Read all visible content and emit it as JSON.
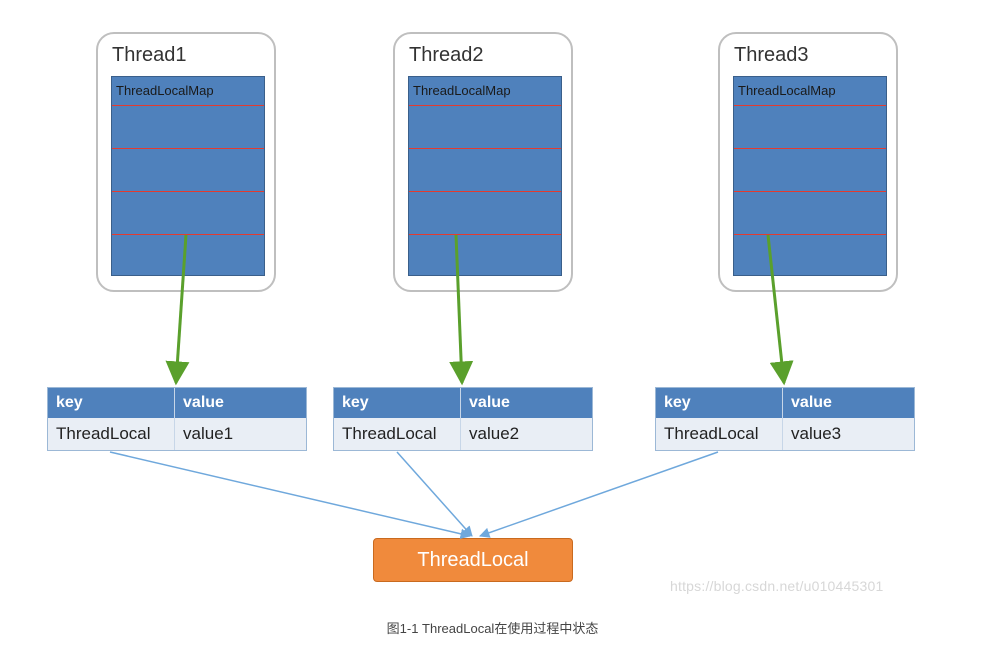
{
  "threads": [
    {
      "title": "Thread1",
      "map_label": "ThreadLocalMap"
    },
    {
      "title": "Thread2",
      "map_label": "ThreadLocalMap"
    },
    {
      "title": "Thread3",
      "map_label": "ThreadLocalMap"
    }
  ],
  "tables": [
    {
      "key_header": "key",
      "value_header": "value",
      "key": "ThreadLocal",
      "value": "value1"
    },
    {
      "key_header": "key",
      "value_header": "value",
      "key": "ThreadLocal",
      "value": "value2"
    },
    {
      "key_header": "key",
      "value_header": "value",
      "key": "ThreadLocal",
      "value": "value3"
    }
  ],
  "target": {
    "label": "ThreadLocal"
  },
  "caption": "图1-1  ThreadLocal在使用过程中状态",
  "watermark": "https://blog.csdn.net/u010445301",
  "colors": {
    "block_fill": "#4f81bc",
    "row_divider": "#e43b2f",
    "arrow_green": "#5aa02c",
    "arrow_blue": "#6fa8dc",
    "target_fill": "#f08a3c"
  }
}
